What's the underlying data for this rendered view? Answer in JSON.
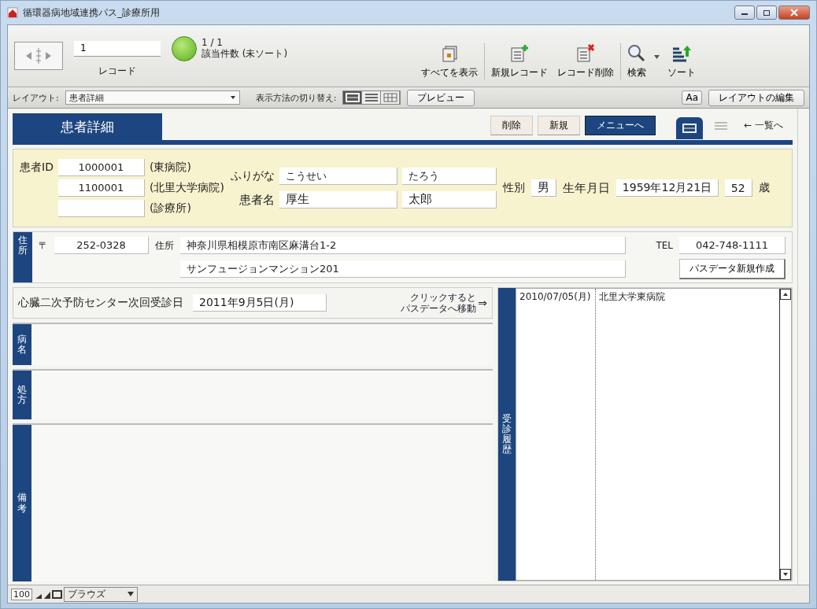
{
  "window": {
    "title": "循環器病地域連携パス_診療所用"
  },
  "toolbar": {
    "record_number": "1",
    "record_label": "レコード",
    "found_count": "1 / 1",
    "found_status": "該当件数 (未ソート)",
    "buttons": [
      {
        "kind": "show-all",
        "label": "すべてを表示"
      },
      {
        "kind": "new",
        "label": "新規レコード"
      },
      {
        "kind": "delete",
        "label": "レコード削除"
      },
      {
        "kind": "find",
        "label": "検索"
      },
      {
        "kind": "sort",
        "label": "ソート"
      }
    ]
  },
  "layout_bar": {
    "layout_label": "レイアウト:",
    "layout_value": "患者詳細",
    "view_label": "表示方法の切り替え:",
    "views": [
      {
        "kind": "form",
        "selected": true
      },
      {
        "kind": "list",
        "selected": false
      },
      {
        "kind": "table",
        "selected": false
      }
    ],
    "preview": "プレビュー",
    "font_button": "Aa",
    "edit_layout": "レイアウトの編集"
  },
  "header": {
    "title": "患者詳細",
    "buttons": [
      {
        "kind": "plain",
        "label": "削除"
      },
      {
        "kind": "plain",
        "label": "新規"
      },
      {
        "kind": "dark",
        "label": "メニューへ"
      }
    ],
    "view_tabs": [
      {
        "kind": "form",
        "selected": true
      },
      {
        "kind": "list",
        "selected": false
      }
    ],
    "list_link": "← 一覧へ"
  },
  "patient": {
    "id_label": "患者ID",
    "ids": [
      {
        "value": "1000001",
        "note": "(東病院)"
      },
      {
        "value": "1100001",
        "note": "(北里大学病院)"
      },
      {
        "note": "(診療所)"
      }
    ],
    "furigana_label": "ふりがな",
    "furigana": [
      "こうせい",
      "たろう"
    ],
    "name_label": "患者名",
    "name": [
      "厚生",
      "太郎"
    ],
    "sex_label": "性別",
    "sex": "男",
    "birth_label": "生年月日",
    "birth": "1959年12月21日",
    "age": "52",
    "age_unit": "歳"
  },
  "address": {
    "section": "住所",
    "postal_mark": "〒",
    "postal": "252-0328",
    "address_label": "住所",
    "lines": [
      "神奈川県相模原市南区麻溝台1-2",
      "サンフュージョンマンション201"
    ],
    "tel_label": "TEL",
    "tel": "042-748-1111",
    "new_path_button": "パスデータ新規作成"
  },
  "next_visit": {
    "label": "心臓二次予防センター次回受診日",
    "date": "2011年9月5日(月)",
    "link_lines": [
      "クリックすると",
      "パスデータへ移動"
    ],
    "arrow": "⇒"
  },
  "sections": [
    {
      "label": "病名"
    },
    {
      "label": "処方"
    },
    {
      "label": "備考"
    }
  ],
  "history": {
    "label": "受診履歴",
    "rows": [
      {
        "date": "2010/07/05(月)",
        "hospital": "北里大学東病院"
      }
    ]
  },
  "status_bar": {
    "zoom": "100",
    "mode": "ブラウズ"
  }
}
